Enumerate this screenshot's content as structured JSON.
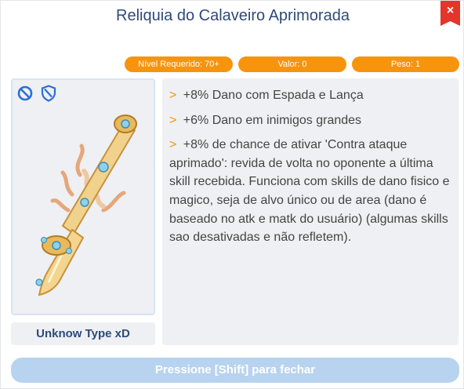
{
  "window": {
    "title": "Reliquia do Calaveiro Aprimorada",
    "close_label": "×"
  },
  "badges": {
    "required_level": "Nível Requerido: 70+",
    "value": "Valor: 0",
    "weight": "Peso: 1"
  },
  "item": {
    "type_label": "Unknow Type xD",
    "icons": [
      "no-entry-icon",
      "shield-icon"
    ]
  },
  "description": {
    "bullet": ">",
    "lines": [
      "+8% Dano com Espada e Lança",
      "+6% Dano em inimigos grandes",
      "+8% de chance de ativar 'Contra ataque aprimado': revida de volta no oponente a última skill recebida. Funciona com skills de dano fisico e magico, seja de alvo único ou de area (dano é baseado no atk e matk do usuário) (algumas skills sao desativadas e não refletem)."
    ]
  },
  "footer": {
    "close_hint": "Pressione [Shift] para fechar"
  },
  "colors": {
    "accent_orange": "#f7940d",
    "title_blue": "#2e4a7a",
    "close_red": "#e3352a",
    "footer_button": "#b7d3ef",
    "panel_bg": "#eef0f3"
  }
}
